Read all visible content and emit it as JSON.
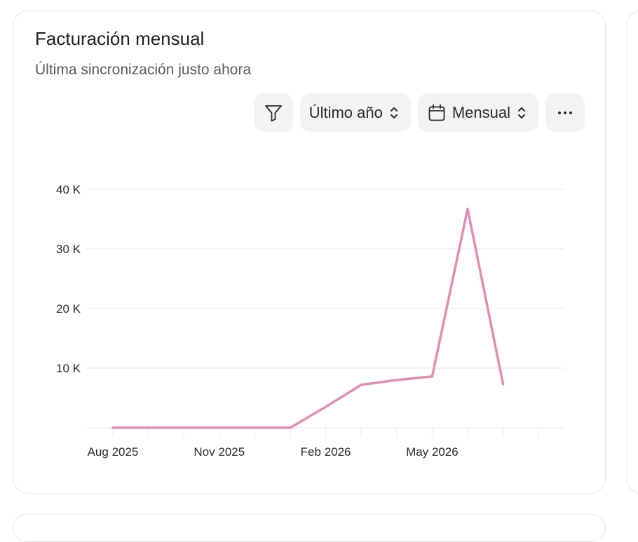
{
  "card": {
    "title": "Facturación mensual",
    "subtitle": "Última sincronización justo ahora"
  },
  "toolbar": {
    "filter_icon": "filter-icon",
    "range_label": "Último año",
    "range_icon": "chevron-up-down-icon",
    "period_icon": "calendar-icon",
    "period_label": "Mensual",
    "period_chevron_icon": "chevron-up-down-icon",
    "more_icon": "more-horizontal-icon"
  },
  "chart_data": {
    "type": "line",
    "x": [
      "2025-08",
      "2025-09",
      "2025-10",
      "2025-11",
      "2025-12",
      "2026-01",
      "2026-02",
      "2026-03",
      "2026-04",
      "2026-05",
      "2026-06",
      "2026-07",
      "2026-08"
    ],
    "x_tick_labels": [
      "Aug 2025",
      "Nov 2025",
      "Feb 2026",
      "May 2026"
    ],
    "x_tick_positions": [
      "2025-08",
      "2025-11",
      "2026-02",
      "2026-05"
    ],
    "series": [
      {
        "values": [
          0,
          0,
          0,
          0,
          0,
          0,
          3500,
          7200,
          8000,
          8600,
          36700,
          7300
        ],
        "color": "#e58cb2"
      }
    ],
    "y_ticks": [
      10000,
      20000,
      30000,
      40000
    ],
    "y_tick_labels": [
      "10 K",
      "20 K",
      "30 K",
      "40 K"
    ],
    "ylim": [
      0,
      40000
    ],
    "grid": true,
    "grid_color": "#efefef",
    "title": "",
    "xlabel": "",
    "ylabel": ""
  }
}
